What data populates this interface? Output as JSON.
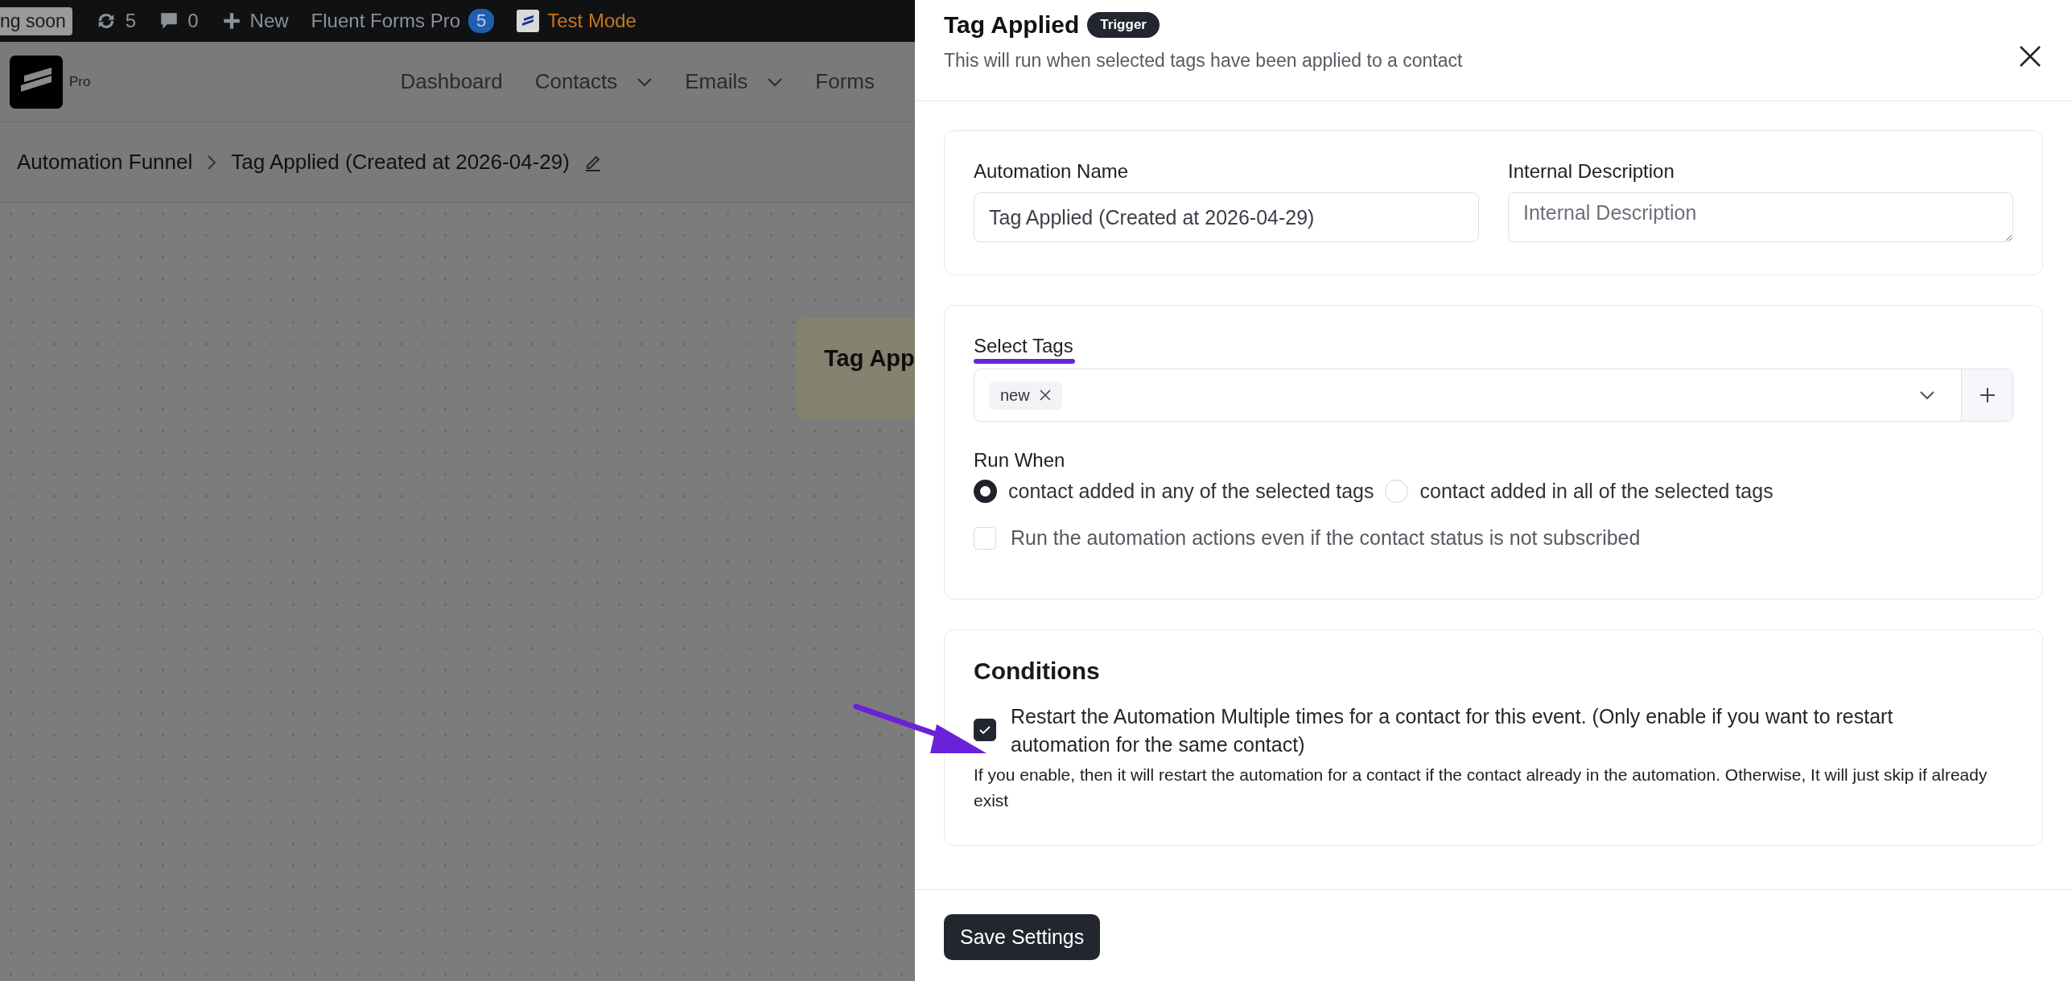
{
  "admin_bar": {
    "items": [
      {
        "kind": "label",
        "text": "ng soon"
      },
      {
        "kind": "updates",
        "text": "5"
      },
      {
        "kind": "comments",
        "text": "0"
      },
      {
        "kind": "new",
        "text": "New"
      },
      {
        "kind": "plugin",
        "text": "Fluent Forms Pro",
        "badge": "5"
      },
      {
        "kind": "mode",
        "text": "Test Mode"
      }
    ]
  },
  "header": {
    "logo_label": "Pro",
    "nav": [
      {
        "label": "Dashboard",
        "dropdown": false
      },
      {
        "label": "Contacts",
        "dropdown": true
      },
      {
        "label": "Emails",
        "dropdown": true
      },
      {
        "label": "Forms",
        "dropdown": false
      }
    ]
  },
  "breadcrumb": [
    "Automation Funnel",
    "Tag Applied (Created at 2026-04-29)"
  ],
  "canvas": {
    "node": {
      "title": "Tag App"
    }
  },
  "drawer": {
    "title": "Tag Applied",
    "badge": "Trigger",
    "subtitle": "This will run when selected tags have been applied to a contact",
    "name_field": {
      "label": "Automation Name",
      "value": "Tag Applied (Created at 2026-04-29)"
    },
    "description_field": {
      "label": "Internal Description",
      "placeholder": "Internal Description"
    },
    "tags": {
      "label": "Select Tags",
      "values": [
        "new"
      ]
    },
    "run_when": {
      "label": "Run When",
      "options": [
        {
          "label": "contact added in any of the selected tags",
          "selected": true
        },
        {
          "label": "contact added in all of the selected tags",
          "selected": false
        }
      ]
    },
    "run_unsubscribed": {
      "label": "Run the automation actions even if the contact status is not subscribed",
      "checked": false
    },
    "conditions": {
      "title": "Conditions",
      "restart": {
        "label": "Restart the Automation Multiple times for a contact for this event. (Only enable if you want to restart automation for the same contact)",
        "checked": true
      },
      "help": "If you enable, then it will restart the automation for a contact if the contact already in the automation. Otherwise, It will just skip if already exist"
    },
    "save_button": "Save Settings"
  }
}
